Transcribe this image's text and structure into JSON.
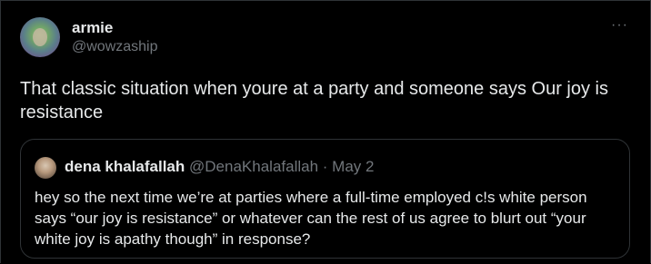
{
  "author": {
    "display_name": "armie",
    "handle": "@wowzaship"
  },
  "more_icon": "more-horizontal-icon",
  "more_glyph": "···",
  "tweet": {
    "text": "That classic situation when youre at a party and someone says Our joy is resistance"
  },
  "quoted": {
    "display_name": "dena khalafallah",
    "handle": "@DenaKhalafallah",
    "separator": " · ",
    "date": "May 2",
    "text": "hey so the next time we’re at parties where a full-time employed c!s white person says “our joy is resistance” or whatever can the rest of us agree to blurt out “your white joy is apathy though” in response?"
  },
  "colors": {
    "background": "#000000",
    "text": "#e7e9ea",
    "muted": "#71767b",
    "border": "#2f3336"
  }
}
